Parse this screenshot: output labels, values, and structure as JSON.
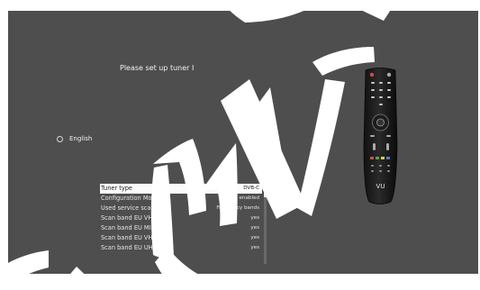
{
  "setup": {
    "title": "Please set up tuner I",
    "language": {
      "label": "English"
    },
    "settings": [
      {
        "label": "Tuner type",
        "value": "DVB-C",
        "selected": true
      },
      {
        "label": "Configuration Mode",
        "value": "enabled",
        "selected": false
      },
      {
        "label": "Used service scan type",
        "value": "Frequency bands",
        "selected": false
      },
      {
        "label": "Scan band EU VHF I",
        "value": "yes",
        "selected": false
      },
      {
        "label": "Scan band EU MID",
        "value": "yes",
        "selected": false
      },
      {
        "label": "Scan band EU VHF III",
        "value": "yes",
        "selected": false
      },
      {
        "label": "Scan band EU UHF IV",
        "value": "yes",
        "selected": false
      }
    ]
  },
  "remote": {
    "logo": "VU"
  },
  "watermark": {
    "text": "DOWN",
    "color": "#ffffff"
  }
}
